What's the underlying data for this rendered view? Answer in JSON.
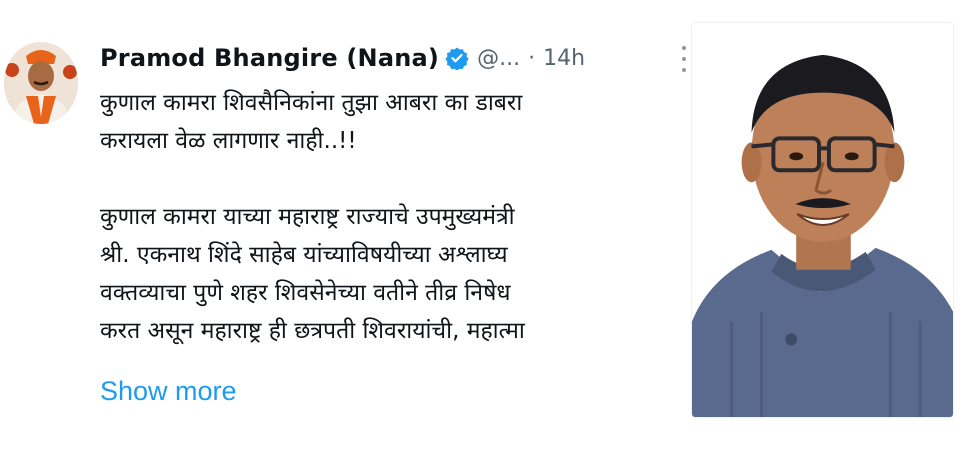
{
  "tweet": {
    "author": {
      "display_name": "Pramod Bhangire (Nana)",
      "handle": "@...",
      "verified": true,
      "verified_icon": "verified-badge-icon",
      "verified_color": "#1d9bf0"
    },
    "separator": "·",
    "timestamp": "14h",
    "more_icon": "more-vertical-icon",
    "text_lines": [
      "कुणाल कामरा शिवसैनिकांना  तुझा आबरा का डाबरा",
      "करायला वेळ लागणार नाही..!!",
      "",
      " कुणाल कामरा याच्या महाराष्ट्र राज्याचे उपमुख्यमंत्री",
      "श्री. एकनाथ शिंदे साहेब यांच्याविषयीच्या अश्लाघ्य",
      "वक्तव्याचा  पुणे शहर शिवसेनेच्या वतीने  तीव्र निषेध",
      "करत असून महाराष्ट्र ही छत्रपती शिवरायांची, महात्मा"
    ],
    "show_more_label": "Show more",
    "link_color": "#1d9bf0"
  }
}
